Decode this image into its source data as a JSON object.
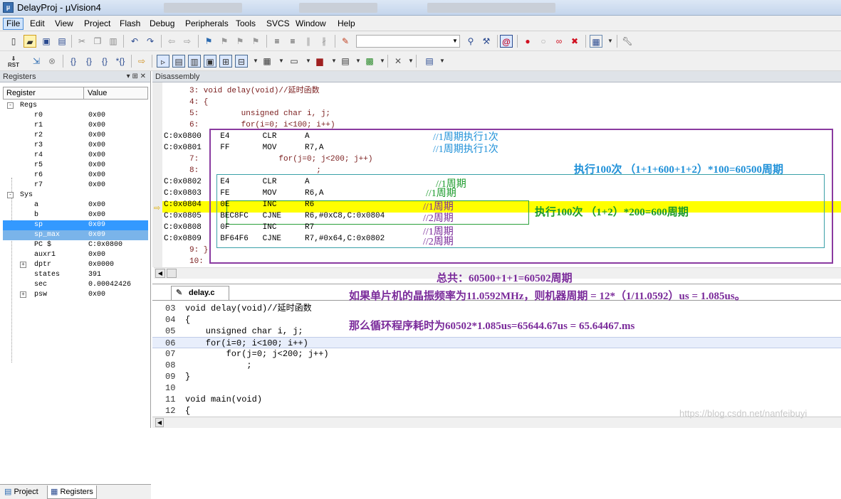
{
  "window": {
    "title": "DelayProj - µVision4"
  },
  "menu": [
    "File",
    "Edit",
    "View",
    "Project",
    "Flash",
    "Debug",
    "Peripherals",
    "Tools",
    "SVCS",
    "Window",
    "Help"
  ],
  "registers_panel": {
    "title": "Registers",
    "columns": [
      "Register",
      "Value"
    ],
    "rows": [
      {
        "name": "Regs",
        "value": "",
        "indent": 0,
        "expander": "-"
      },
      {
        "name": "r0",
        "value": "0x00",
        "indent": 2
      },
      {
        "name": "r1",
        "value": "0x00",
        "indent": 2
      },
      {
        "name": "r2",
        "value": "0x00",
        "indent": 2
      },
      {
        "name": "r3",
        "value": "0x00",
        "indent": 2
      },
      {
        "name": "r4",
        "value": "0x00",
        "indent": 2
      },
      {
        "name": "r5",
        "value": "0x00",
        "indent": 2
      },
      {
        "name": "r6",
        "value": "0x00",
        "indent": 2
      },
      {
        "name": "r7",
        "value": "0x00",
        "indent": 2
      },
      {
        "name": "Sys",
        "value": "",
        "indent": 0,
        "expander": "-"
      },
      {
        "name": "a",
        "value": "0x00",
        "indent": 2
      },
      {
        "name": "b",
        "value": "0x00",
        "indent": 2
      },
      {
        "name": "sp",
        "value": "0x09",
        "indent": 2,
        "selected": true
      },
      {
        "name": "sp_max",
        "value": "0x09",
        "indent": 2,
        "selected": true
      },
      {
        "name": "PC  $",
        "value": "C:0x0800",
        "indent": 2
      },
      {
        "name": "auxr1",
        "value": "0x00",
        "indent": 2
      },
      {
        "name": "dptr",
        "value": "0x0000",
        "indent": 2,
        "expander": "+"
      },
      {
        "name": "states",
        "value": "391",
        "indent": 2
      },
      {
        "name": "sec",
        "value": "0.00042426",
        "indent": 2
      },
      {
        "name": "psw",
        "value": "0x00",
        "indent": 2,
        "expander": "+"
      }
    ],
    "tabs": [
      "Project",
      "Registers"
    ]
  },
  "disassembly": {
    "title": "Disassembly",
    "lines": [
      {
        "text": "3: void delay(void)//延时函数",
        "kind": "src"
      },
      {
        "text": "4: {",
        "kind": "src"
      },
      {
        "text": "5:         unsigned char i, j;",
        "kind": "src"
      },
      {
        "text": "6:         for(i=0; i<100; i++)",
        "kind": "src"
      },
      {
        "text": "C:0x0800    E4       CLR      A",
        "kind": "asm",
        "current": true
      },
      {
        "text": "C:0x0801    FF       MOV      R7,A",
        "kind": "asm"
      },
      {
        "text": "7:                 for(j=0; j<200; j++)",
        "kind": "src"
      },
      {
        "text": "8:                         ;",
        "kind": "src"
      },
      {
        "text": "C:0x0802    E4       CLR      A",
        "kind": "asm"
      },
      {
        "text": "C:0x0803    FE       MOV      R6,A",
        "kind": "asm"
      },
      {
        "text": "C:0x0804    0E       INC      R6",
        "kind": "asm"
      },
      {
        "text": "C:0x0805    BEC8FC   CJNE     R6,#0xC8,C:0x0804",
        "kind": "asm"
      },
      {
        "text": "C:0x0808    0F       INC      R7",
        "kind": "asm"
      },
      {
        "text": "C:0x0809    BF64F6   CJNE     R7,#0x64,C:0x0802",
        "kind": "asm"
      },
      {
        "text": "9: }",
        "kind": "src"
      },
      {
        "text": "10:",
        "kind": "src"
      }
    ]
  },
  "annotations": {
    "c1": "//1周期执行1次",
    "c2": "//1周期执行1次",
    "outer_loop": "执行100次  （1+1+600+1+2）*100=60500周期",
    "c3": "//1周期",
    "c4": "//1周期",
    "inner_loop": "执行100次  （1+2）*200=600周期",
    "c5": "//1周期",
    "c6": "//2周期",
    "c7": "//1周期",
    "c8": "//2周期",
    "total": "总共：60500+1+1=60502周期",
    "crystal": "如果单片机的晶振频率为11.0592MHz，则机器周期 = 12*（1/11.0592）us = 1.085us。",
    "time": "那么循环程序耗时为60502*1.085us=65644.67us = 65.64467.ms"
  },
  "editor": {
    "tab": "delay.c",
    "lines": [
      {
        "num": "03",
        "code": "void delay(void)//延时函数"
      },
      {
        "num": "04",
        "code": "{"
      },
      {
        "num": "05",
        "code": "    unsigned char i, j;"
      },
      {
        "num": "06",
        "code": "    for(i=0; i<100; i++)",
        "current": true
      },
      {
        "num": "07",
        "code": "        for(j=0; j<200; j++)"
      },
      {
        "num": "08",
        "code": "            ;"
      },
      {
        "num": "09",
        "code": "}"
      },
      {
        "num": "10",
        "code": ""
      },
      {
        "num": "11",
        "code": "void main(void)"
      },
      {
        "num": "12",
        "code": "{"
      }
    ]
  },
  "watermark": "https://blog.csdn.net/nanfeibuyi",
  "icons": {
    "title": "uvision-app-icon",
    "new": "new-file-icon",
    "open": "open-folder-icon",
    "save": "save-icon",
    "undo": "undo-icon",
    "redo": "redo-icon",
    "reset": "reset-icon",
    "run": "run-icon",
    "stop": "stop-icon",
    "step": "step-icon",
    "breakpoint": "breakpoint-icon"
  },
  "colors": {
    "highlight": "#ffff00",
    "purple_box": "#8a3aa0",
    "teal_box": "#3aa0a8",
    "green_box": "#2aa03a",
    "selection": "#3399ff"
  }
}
